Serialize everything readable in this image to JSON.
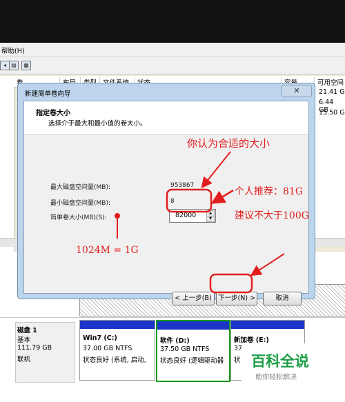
{
  "menu": {
    "help": "帮助(H)"
  },
  "columns": {
    "vol": "卷",
    "layout": "布局",
    "type": "类型",
    "fs": "文件系统",
    "status": "状态",
    "capacity": "容量",
    "free": "可用空间"
  },
  "free_values": [
    "21.41 G",
    "6.44 GB",
    "15.50 G"
  ],
  "wizard": {
    "window_title": "新建简单卷向导",
    "close_symbol": "✕",
    "heading": "指定卷大小",
    "subheading": "选择介于最大和最小值的卷大小。",
    "max_label": "最大磁盘空间量(MB):",
    "max_value": "953867",
    "min_label": "最小磁盘空间量(MB):",
    "min_value": "8",
    "size_label": "简单卷大小(MB)(S):",
    "size_value": "82000",
    "back_button": "< 上一步(B)",
    "next_button": "下一步(N) >",
    "cancel_button": "取消"
  },
  "annotations": {
    "suitable": "你认为合适的大小",
    "recommend": "个人推荐：81G",
    "advice": "建议不大于100G",
    "conversion": "1024M = 1G"
  },
  "disk": {
    "name": "磁盘 1",
    "type": "基本",
    "size": "111.79 GB",
    "state": "联机"
  },
  "partitions": [
    {
      "name": "Win7  (C:)",
      "size": "37.00 GB NTFS",
      "status": "状态良好 (系统, 启动,"
    },
    {
      "name": "软件  (D:)",
      "size": "37.50 GB NTFS",
      "status": "状态良好 (逻辑驱动器"
    },
    {
      "name": "新加卷  (E:)",
      "size": "37",
      "status": "状"
    }
  ],
  "left_fragments": {
    "a": "基",
    "b": "9",
    "c": "联"
  },
  "watermark": {
    "brand": "百科全说",
    "slogan": "助你轻松解决"
  },
  "colors": {
    "annotation": "#e21d1d",
    "partition_bar": "#1c35c9",
    "selected_border": "#1e9a1e",
    "brand": "#1d9e47"
  }
}
